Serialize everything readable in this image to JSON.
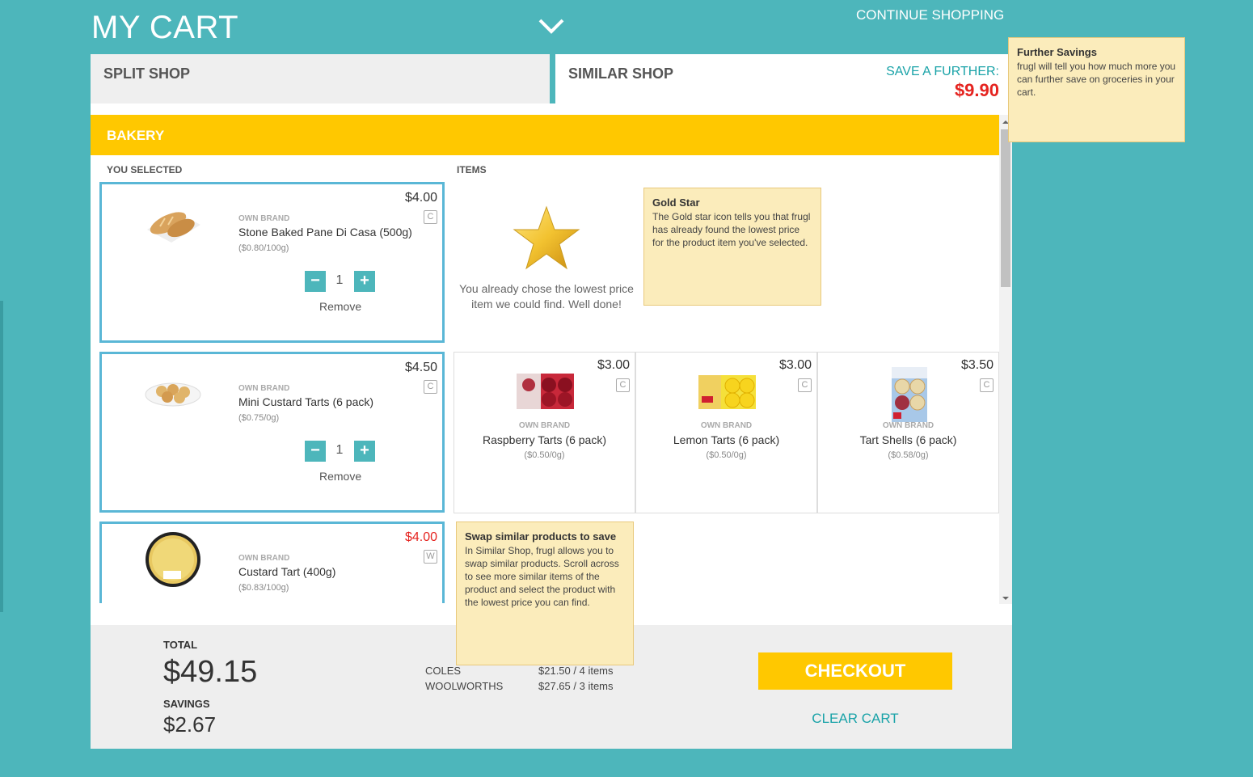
{
  "header": {
    "title": "MY CART",
    "continue_label": "CONTINUE SHOPPING"
  },
  "tabs": {
    "split_label": "SPLIT SHOP",
    "similar_label": "SIMILAR SHOP",
    "save_label": "SAVE A FURTHER:",
    "save_amount": "$9.90"
  },
  "category": {
    "name": "BAKERY",
    "col_selected": "YOU SELECTED",
    "col_items": "ITEMS"
  },
  "selected_items": [
    {
      "price": "$4.00",
      "store": "C",
      "brand": "OWN BRAND",
      "name": "Stone Baked Pane Di Casa (500g)",
      "unit": "($0.80/100g)",
      "qty": "1",
      "remove": "Remove"
    },
    {
      "price": "$4.50",
      "store": "C",
      "brand": "OWN BRAND",
      "name": "Mini Custard Tarts (6 pack)",
      "unit": "($0.75/0g)",
      "qty": "1",
      "remove": "Remove"
    },
    {
      "price": "$4.00",
      "store": "W",
      "brand": "OWN BRAND",
      "name": "Custard Tart (400g)",
      "unit": "($0.83/100g)"
    }
  ],
  "gold_star_message": "You already chose the lowest price item we could find. Well done!",
  "alternatives": [
    {
      "price": "$3.00",
      "store": "C",
      "brand": "OWN BRAND",
      "name": "Raspberry Tarts (6 pack)",
      "unit": "($0.50/0g)"
    },
    {
      "price": "$3.00",
      "store": "C",
      "brand": "OWN BRAND",
      "name": "Lemon Tarts (6 pack)",
      "unit": "($0.50/0g)"
    },
    {
      "price": "$3.50",
      "store": "C",
      "brand": "OWN BRAND",
      "name": "Tart Shells (6 pack)",
      "unit": "($0.58/0g)"
    }
  ],
  "tooltips": {
    "further": {
      "title": "Further Savings",
      "text": "frugl will tell you how much more you can further save on groceries in your cart."
    },
    "gold": {
      "title": "Gold Star",
      "text": "The Gold star icon tells you that frugl has already found the lowest price for the product item you've selected."
    },
    "swap": {
      "title": "Swap similar products to save",
      "text": "In Similar Shop, frugl allows you to swap similar products. Scroll across to see more similar items of the product and select the product with the lowest price you can find."
    }
  },
  "footer": {
    "total_label": "TOTAL",
    "total": "$49.15",
    "savings_label": "SAVINGS",
    "savings": "$2.67",
    "stores": [
      {
        "name": "COLES",
        "value": "$21.50 / 4 items"
      },
      {
        "name": "WOOLWORTHS",
        "value": "$27.65 / 3 items"
      }
    ],
    "checkout_label": "CHECKOUT",
    "clear_label": "CLEAR CART"
  },
  "colors": {
    "background": "#4db6bb",
    "accent_yellow": "#ffc800",
    "save_red": "#e52420",
    "teal_text": "#1aa3a8",
    "selected_border": "#5ab7d6",
    "tooltip_bg": "#fbecbb"
  },
  "icons": {
    "chevron": "chevron-down-icon",
    "minus": "minus-icon",
    "plus": "plus-icon",
    "star": "gold-star-icon"
  }
}
